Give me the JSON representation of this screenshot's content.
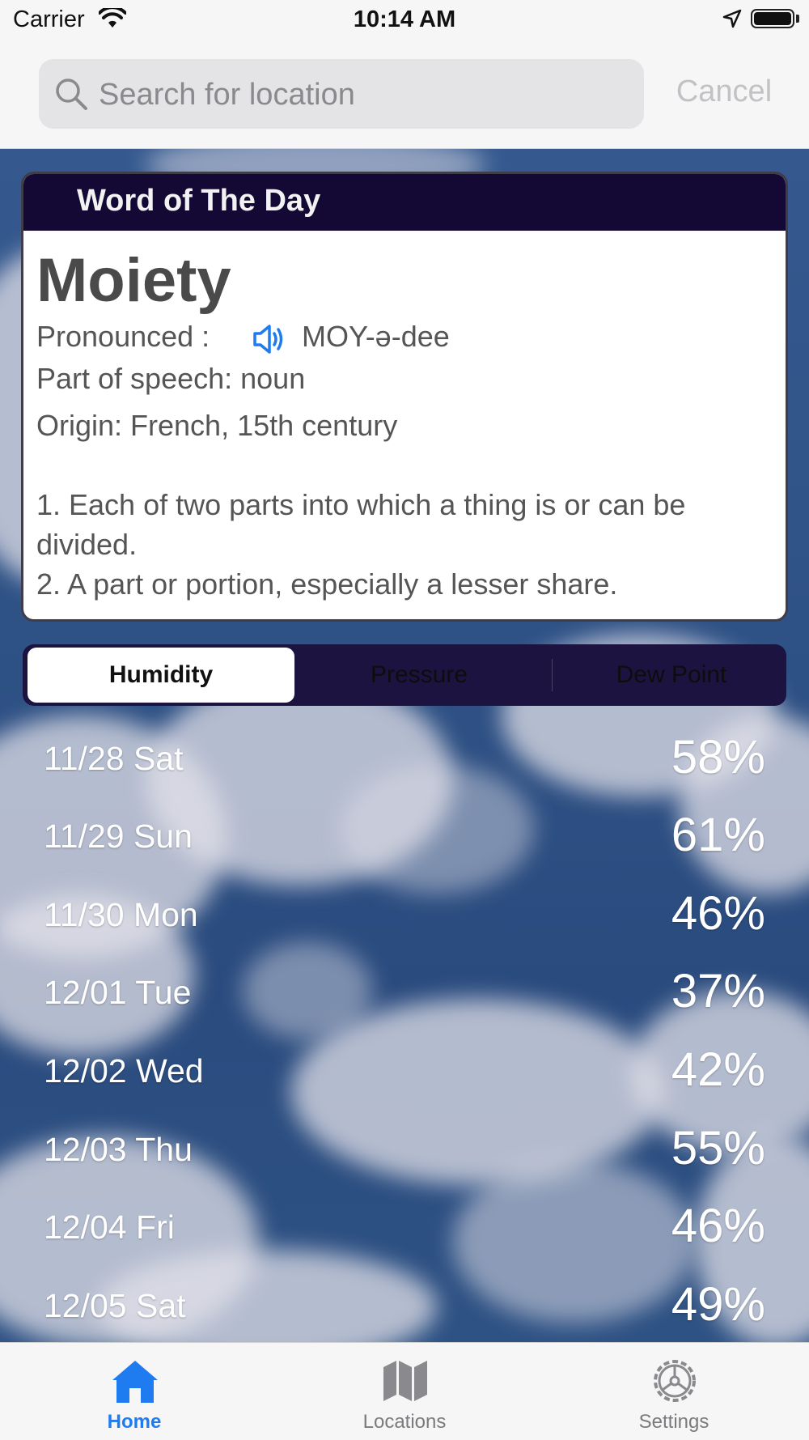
{
  "status_bar": {
    "carrier": "Carrier",
    "time": "10:14 AM"
  },
  "search": {
    "placeholder": "Search for location",
    "value": "",
    "cancel_label": "Cancel"
  },
  "word_of_the_day": {
    "header": "Word of The Day",
    "word": "Moiety",
    "pronounced_label": "Pronounced :",
    "pronunciation": "MOY-ə-dee",
    "part_of_speech": "Part of speech: noun",
    "origin": "Origin: French, 15th century",
    "definition_1": "1. Each of two parts into which a thing is or can be divided.",
    "definition_2": "2. A part or portion, especially a lesser share."
  },
  "segments": [
    {
      "label": "Humidity",
      "selected": true
    },
    {
      "label": "Pressure",
      "selected": false
    },
    {
      "label": "Dew Point",
      "selected": false
    }
  ],
  "forecast": [
    {
      "date": "11/28 Sat",
      "value": "58%"
    },
    {
      "date": "11/29 Sun",
      "value": "61%"
    },
    {
      "date": "11/30 Mon",
      "value": "46%"
    },
    {
      "date": "12/01 Tue",
      "value": "37%"
    },
    {
      "date": "12/02 Wed",
      "value": "42%"
    },
    {
      "date": "12/03 Thu",
      "value": "55%"
    },
    {
      "date": "12/04 Fri",
      "value": "46%"
    },
    {
      "date": "12/05 Sat",
      "value": "49%"
    }
  ],
  "tab_bar": {
    "items": [
      {
        "label": "Home",
        "icon": "house-icon",
        "active": true
      },
      {
        "label": "Locations",
        "icon": "map-icon",
        "active": false
      },
      {
        "label": "Settings",
        "icon": "gear-icon",
        "active": false
      }
    ]
  },
  "colors": {
    "accent": "#1e7bf0",
    "card_header": "#130934",
    "segment_bg": "#1d1340",
    "cancel_disabled": "#c2c2c6"
  }
}
